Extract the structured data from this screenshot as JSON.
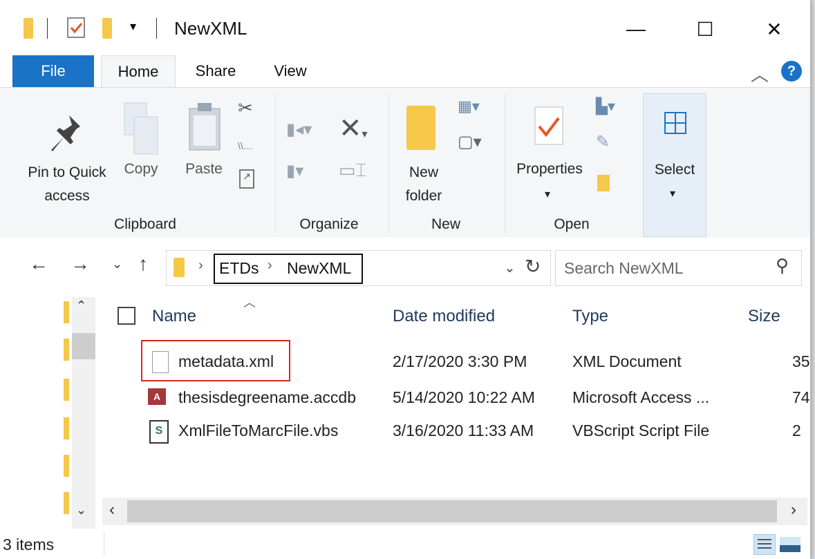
{
  "window": {
    "title": "NewXML",
    "minimize": "—",
    "maximize": "☐",
    "close": "✕"
  },
  "tabs": {
    "file": "File",
    "home": "Home",
    "share": "Share",
    "view": "View"
  },
  "ribbon": {
    "clipboard": {
      "pin_line1": "Pin to Quick",
      "pin_line2": "access",
      "copy": "Copy",
      "paste": "Paste",
      "group": "Clipboard"
    },
    "organize": {
      "group": "Organize"
    },
    "new": {
      "folder_line1": "New",
      "folder_line2": "folder",
      "group": "New"
    },
    "open": {
      "properties": "Properties",
      "group": "Open"
    },
    "select": {
      "label": "Select"
    }
  },
  "address": {
    "crumbs": [
      "ETDs",
      "NewXML"
    ],
    "search_placeholder": "Search NewXML"
  },
  "columns": {
    "name": "Name",
    "date": "Date modified",
    "type": "Type",
    "size": "Size"
  },
  "files": [
    {
      "name": "metadata.xml",
      "date": "2/17/2020 3:30 PM",
      "type": "XML Document",
      "size": "35",
      "icon": "xml-file-icon"
    },
    {
      "name": "thesisdegreename.accdb",
      "date": "5/14/2020 10:22 AM",
      "type": "Microsoft Access ...",
      "size": "74",
      "icon": "access-file-icon"
    },
    {
      "name": "XmlFileToMarcFile.vbs",
      "date": "3/16/2020 11:33 AM",
      "type": "VBScript Script File",
      "size": "2",
      "icon": "vbs-file-icon"
    }
  ],
  "status": {
    "count": "3 items"
  },
  "colors": {
    "accent": "#1a73c6",
    "highlight_box": "#d22"
  }
}
